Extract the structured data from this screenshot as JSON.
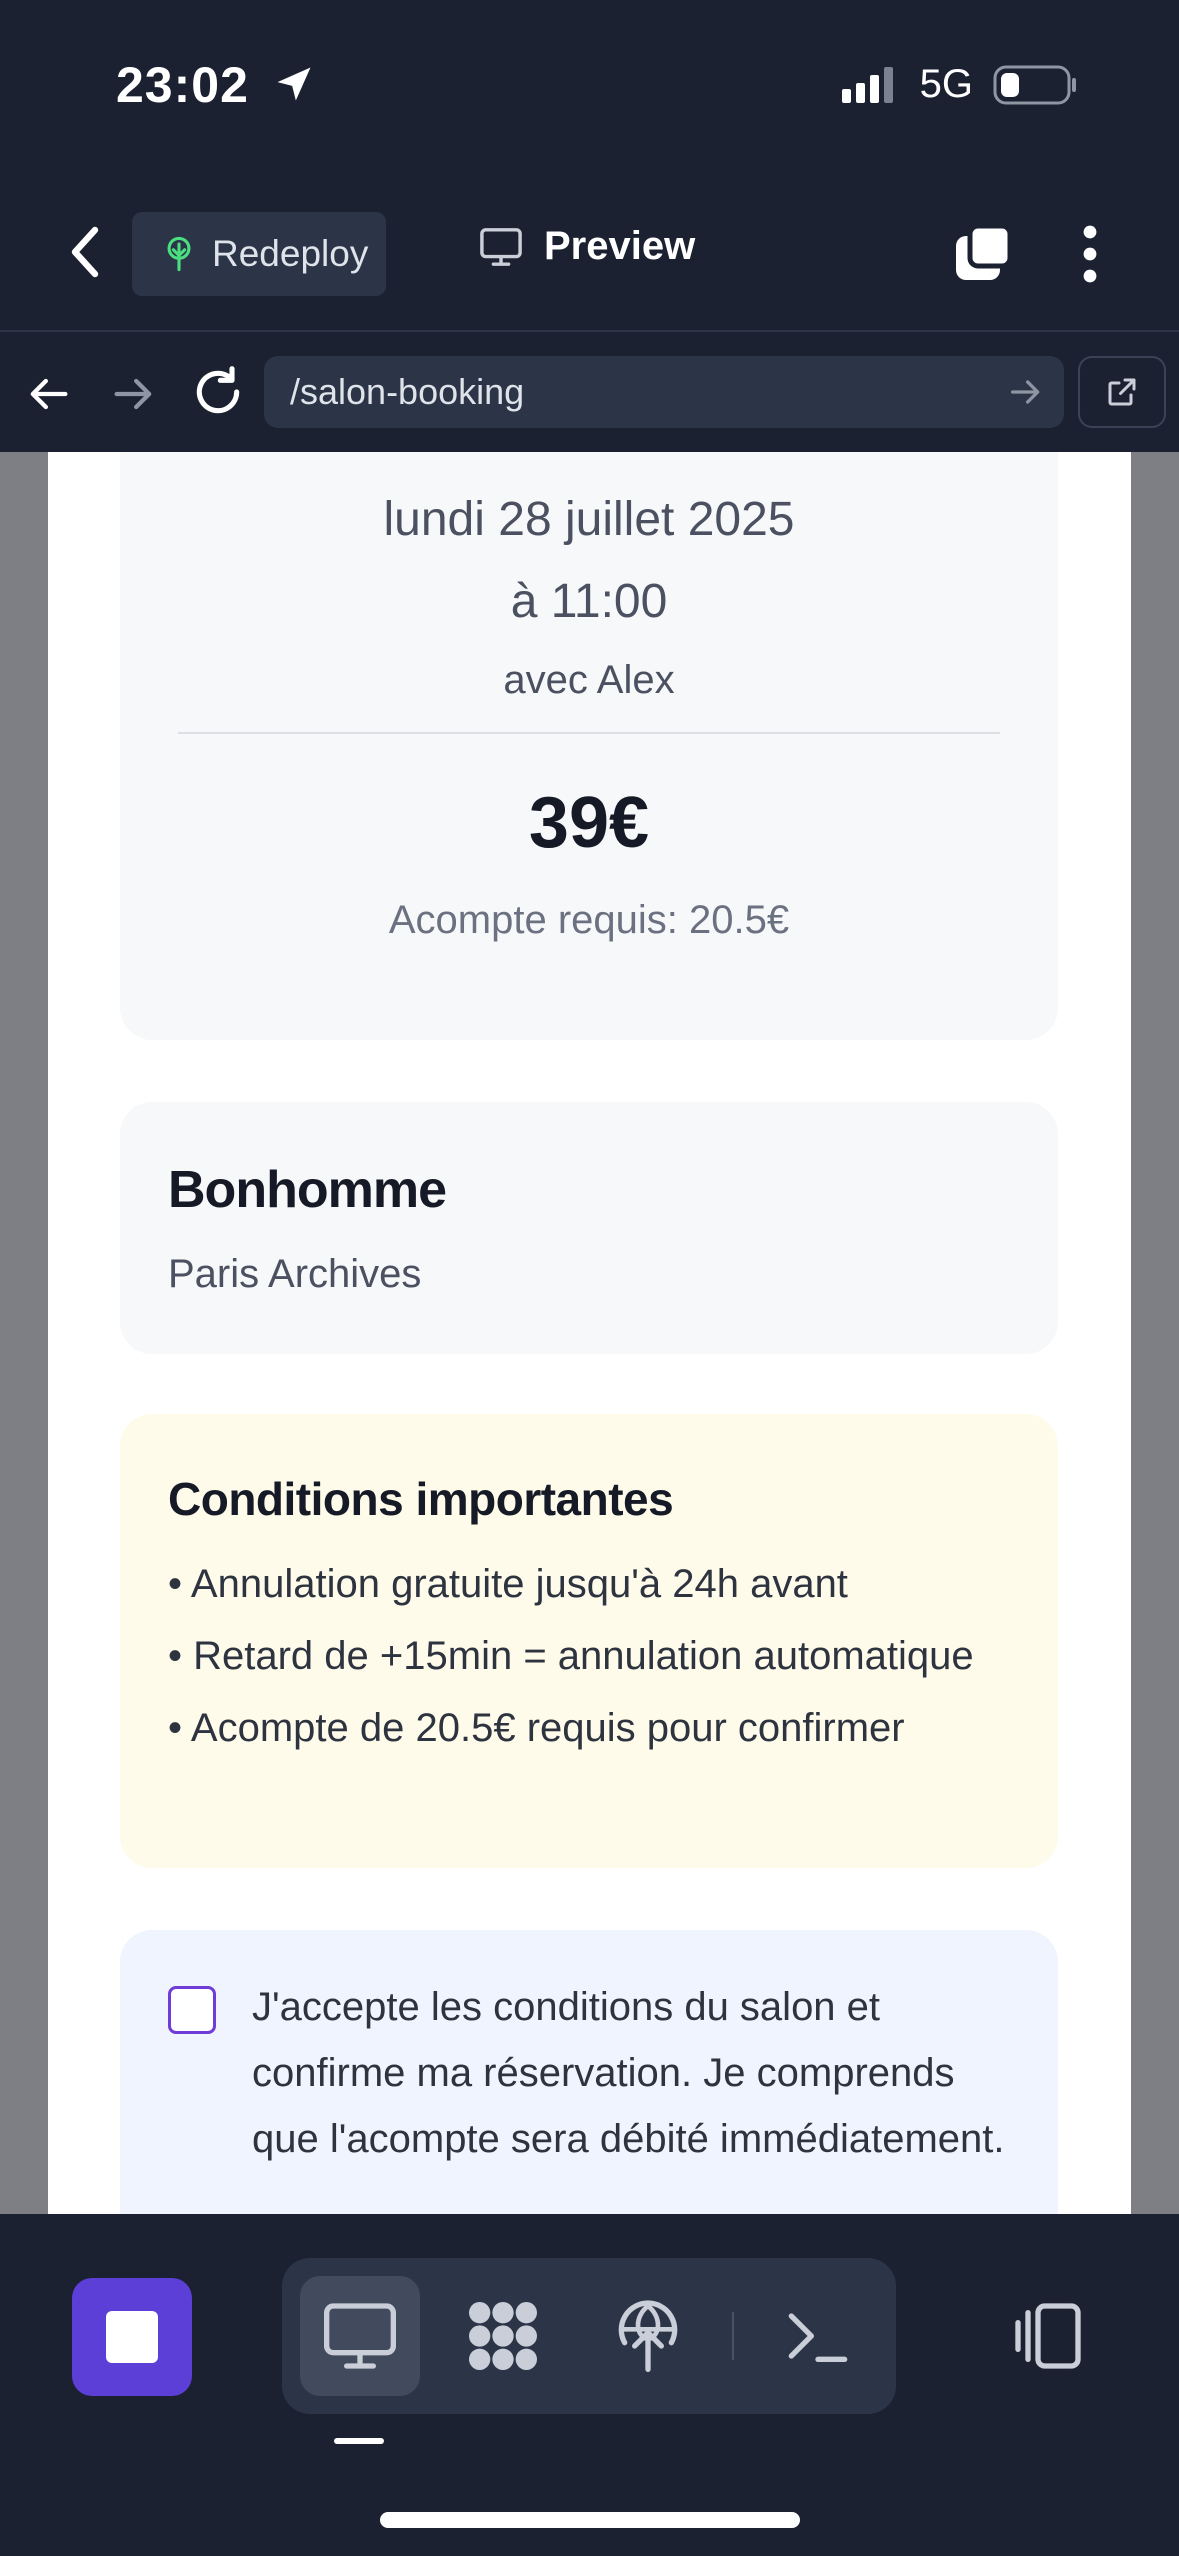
{
  "status_bar": {
    "time": "23:02",
    "network": "5G"
  },
  "header": {
    "redeploy_label": "Redeploy",
    "preview_label": "Preview"
  },
  "browser": {
    "url": "/salon-booking"
  },
  "summary": {
    "date": "lundi 28 juillet 2025",
    "time": "à 11:00",
    "stylist": "avec Alex",
    "price": "39€",
    "deposit": "Acompte requis: 20.5€"
  },
  "salon": {
    "name": "Bonhomme",
    "location": "Paris Archives"
  },
  "conditions": {
    "title": "Conditions importantes",
    "items": [
      "• Annulation gratuite jusqu'à 24h avant",
      "• Retard de +15min = annulation automatique",
      "• Acompte de 20.5€ requis pour confirmer"
    ]
  },
  "accept": {
    "checked": false,
    "text": "J'accepte les conditions du salon et confirme ma réservation. Je comprends que l'acompte sera débité immédiatement."
  },
  "colors": {
    "chrome_bg": "#1b2130",
    "accent": "#5b3fd6",
    "conditions_bg": "#fefbea",
    "accept_bg": "#eff4fe",
    "redeploy_icon": "#4ade80"
  },
  "icons": {
    "back": "chevron-left-icon",
    "redeploy": "tree-icon",
    "preview": "monitor-icon",
    "tabs": "tabs-icon",
    "more": "more-vertical-icon",
    "nav_back": "arrow-left-icon",
    "nav_forward": "arrow-right-icon",
    "reload": "reload-icon",
    "go": "arrow-right-icon",
    "external": "external-link-icon",
    "stop": "stop-icon",
    "desktop": "monitor-icon",
    "apps": "grid-blob-icon",
    "deploy": "globe-up-icon",
    "terminal": "terminal-icon",
    "panels": "panel-icon"
  }
}
